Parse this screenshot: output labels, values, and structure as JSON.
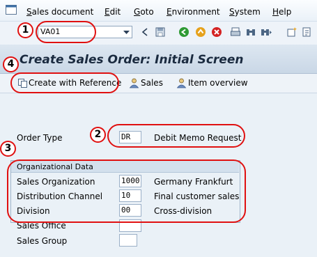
{
  "menu": {
    "items": [
      {
        "label": "Sales document",
        "underline": "S",
        "rest": "ales document"
      },
      {
        "label": "Edit",
        "underline": "E",
        "rest": "dit"
      },
      {
        "label": "Goto",
        "underline": "G",
        "rest": "oto"
      },
      {
        "label": "Environment",
        "underline": "E",
        "rest": "nvironment"
      },
      {
        "label": "System",
        "underline": "S",
        "rest": "ystem"
      },
      {
        "label": "Help",
        "underline": "H",
        "rest": "elp"
      }
    ]
  },
  "toolbar": {
    "command_value": "VA01"
  },
  "title": "Create Sales Order: Initial Screen",
  "app_toolbar": {
    "create_with_reference": "Create with Reference",
    "sales": "Sales",
    "item_overview": "Item overview"
  },
  "form": {
    "order_type_label": "Order Type",
    "order_type_value": "DR",
    "order_type_desc": "Debit Memo Request",
    "org_header": "Organizational Data",
    "sales_org_label": "Sales Organization",
    "sales_org_value": "1000",
    "sales_org_desc": "Germany Frankfurt",
    "dist_channel_label": "Distribution Channel",
    "dist_channel_value": "10",
    "dist_channel_desc": "Final customer sales",
    "division_label": "Division",
    "division_value": "00",
    "division_desc": "Cross-division",
    "sales_office_label": "Sales Office",
    "sales_office_value": "",
    "sales_group_label": "Sales Group",
    "sales_group_value": ""
  },
  "markers": [
    "1",
    "2",
    "3",
    "4"
  ],
  "colors": {
    "highlight": "#e01010",
    "title": "#1a2a3f",
    "background": "#eaf1f7"
  }
}
